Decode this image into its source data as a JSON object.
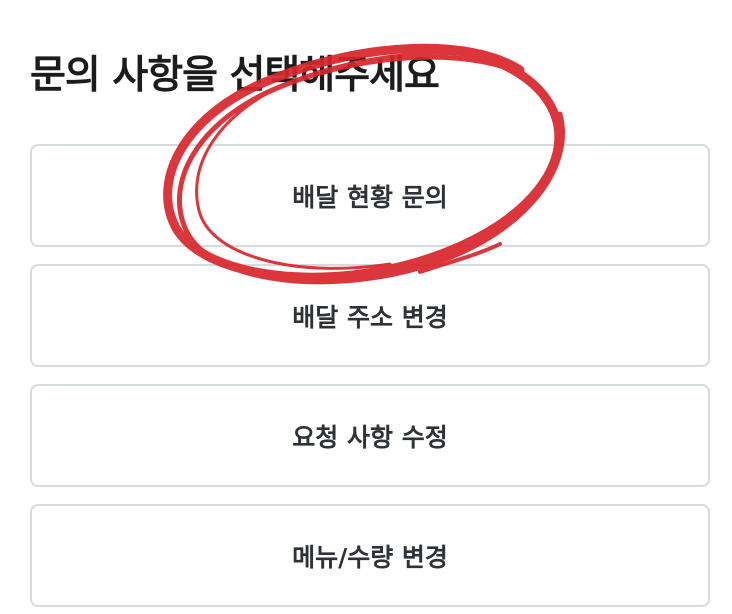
{
  "page": {
    "title": "문의 사항을 선택해주세요"
  },
  "options": [
    {
      "label": "배달 현황 문의"
    },
    {
      "label": "배달 주소 변경"
    },
    {
      "label": "요청 사항 수정"
    },
    {
      "label": "메뉴/수량 변경"
    }
  ],
  "annotation": {
    "shape": "hand-drawn-circle",
    "color": "#d8262b",
    "target": "배달 현황 문의"
  }
}
